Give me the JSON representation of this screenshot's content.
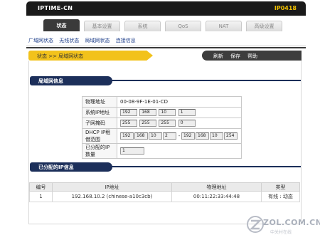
{
  "header": {
    "brand": "IPTIME-CN",
    "model": "IP0418"
  },
  "tabs": [
    {
      "label": "状态",
      "active": true
    },
    {
      "label": "基本设置",
      "active": false
    },
    {
      "label": "系统",
      "active": false
    },
    {
      "label": "QoS",
      "active": false
    },
    {
      "label": "NAT",
      "active": false
    },
    {
      "label": "高级设置",
      "active": false
    }
  ],
  "subnav": [
    "广域网状态",
    "无线状态",
    "局域网状态",
    "连接信息"
  ],
  "breadcrumb": "状态 >> 局域网状态",
  "actions": {
    "refresh": "刷新",
    "save": "保存",
    "help": "帮助"
  },
  "lan_section": {
    "title": "局域网信息",
    "mac_label": "物理地址",
    "mac_value": "00-08-9F-1E-01-CD",
    "ip_label": "系统IP地址",
    "ip": [
      "192",
      "168",
      "10",
      "1"
    ],
    "mask_label": "子网掩码",
    "mask": [
      "255",
      "255",
      "255",
      "0"
    ],
    "dhcp_label": "DHCP IP租借范围",
    "dhcp_start": [
      "192",
      "168",
      "10",
      "2"
    ],
    "dhcp_sep": "-",
    "dhcp_end": [
      "192",
      "168",
      "10",
      "254"
    ],
    "assigned_label": "已分配的IP数量",
    "assigned_value": "1"
  },
  "clients_section": {
    "title": "已分配的IP信息",
    "columns": [
      "编号",
      "IP地址",
      "物理地址",
      "类型"
    ],
    "rows": [
      {
        "num": "1",
        "ip": "192.168.10.2 (chinese-a10c3cb)",
        "mac": "00:11:22:33:44:48",
        "type": "有线 : 动态"
      }
    ]
  },
  "watermark": {
    "text": "ZOL.COM.CN",
    "sub": "中关村在线"
  },
  "colors": {
    "nav_dark": "#1c2f5a",
    "breadcrumb": "#f2c21b",
    "topbar": "#1a1a1a",
    "model": "#f0c000"
  }
}
